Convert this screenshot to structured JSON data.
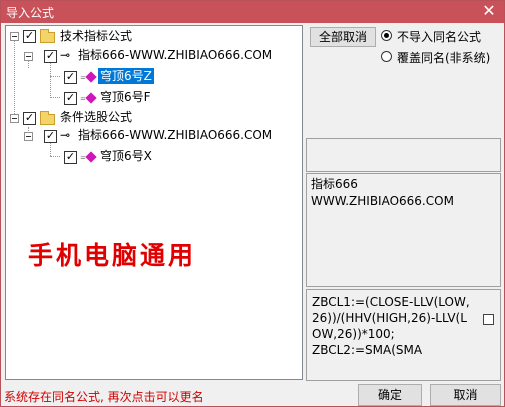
{
  "window": {
    "title": "导入公式",
    "close_glyph": "✕"
  },
  "tree": {
    "groups": [
      {
        "label": "技术指标公式",
        "checked": true,
        "children": [
          {
            "label": "指标666-WWW.ZHIBIAO666.COM",
            "checked": true,
            "children": [
              {
                "label": "穹顶6号Z",
                "checked": true,
                "selected": true
              },
              {
                "label": "穹顶6号F",
                "checked": true,
                "selected": false
              }
            ]
          }
        ]
      },
      {
        "label": "条件选股公式",
        "checked": true,
        "children": [
          {
            "label": "指标666-WWW.ZHIBIAO666.COM",
            "checked": true,
            "children": [
              {
                "label": "穹顶6号X",
                "checked": true,
                "selected": false
              }
            ]
          }
        ]
      }
    ],
    "check_glyph": "✓",
    "key_glyph": "⊸"
  },
  "watermark": "手机电脑通用",
  "options": {
    "cancel_all_label": "全部取消",
    "radio_no_import": "不导入同名公式",
    "radio_overwrite": "覆盖同名(非系统)"
  },
  "info_panel": {
    "line1": "指标666",
    "line2": "WWW.ZHIBIAO666.COM"
  },
  "code_panel": {
    "text": "ZBCL1:=(CLOSE-LLV(LOW,26))/(HHV(HIGH,26)-LLV(LOW,26))*100;\nZBCL2:=SMA(SMA"
  },
  "status": "系统存在同名公式, 再次点击可以更名",
  "buttons": {
    "ok": "确定",
    "cancel": "取消"
  }
}
